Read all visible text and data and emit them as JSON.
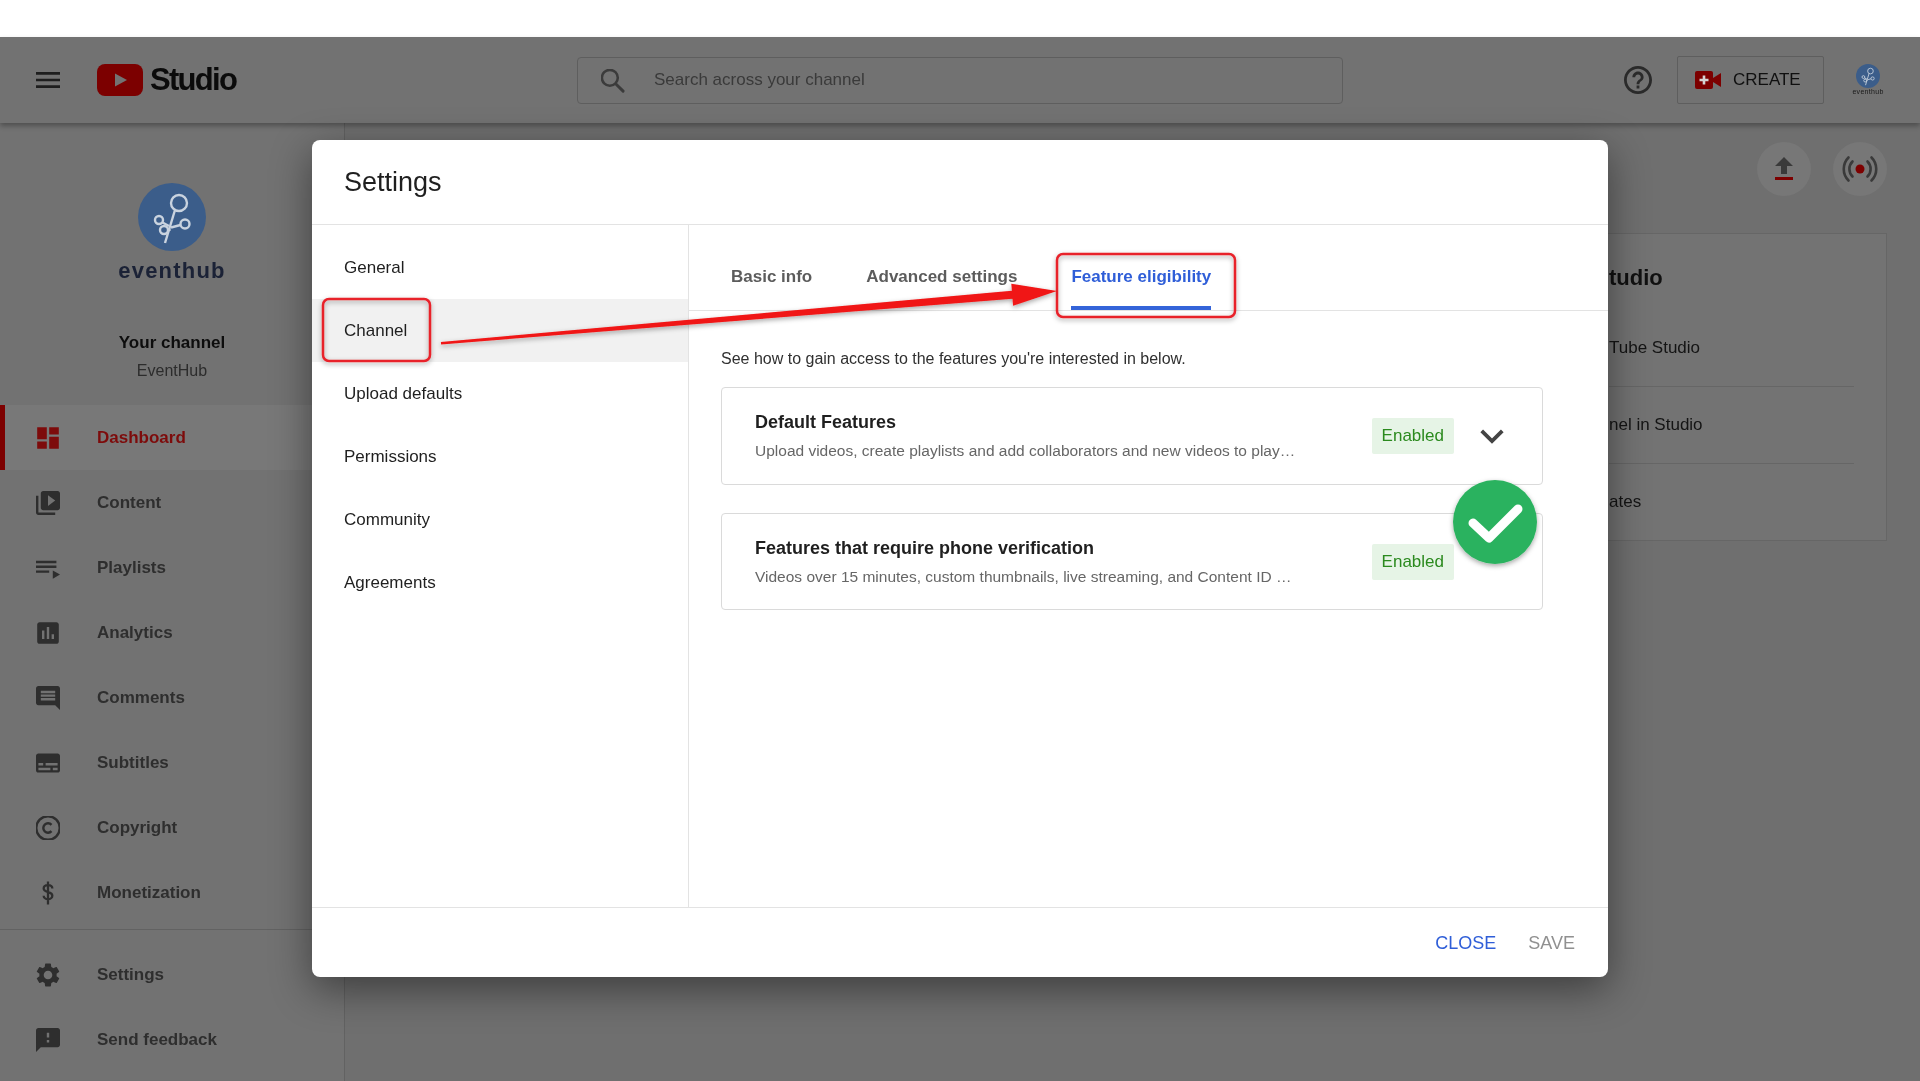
{
  "topbar": {
    "logo_text": "Studio",
    "search": {
      "placeholder": "Search across your channel"
    },
    "create_button": "CREATE",
    "account_label": "eventhub"
  },
  "sidebar": {
    "logo_text": "eventhub",
    "channel_title": "Your channel",
    "channel_name": "EventHub",
    "items": [
      {
        "label": "Dashboard",
        "selected": true
      },
      {
        "label": "Content",
        "selected": false
      },
      {
        "label": "Playlists",
        "selected": false
      },
      {
        "label": "Analytics",
        "selected": false
      },
      {
        "label": "Comments",
        "selected": false
      },
      {
        "label": "Subtitles",
        "selected": false
      },
      {
        "label": "Copyright",
        "selected": false
      },
      {
        "label": "Monetization",
        "selected": false
      }
    ],
    "footer_items": [
      {
        "label": "Settings",
        "selected": false
      },
      {
        "label": "Send feedback",
        "selected": false
      }
    ]
  },
  "background_card": {
    "title": "tudio",
    "rows": [
      "Tube Studio",
      "nel in Studio",
      "ates"
    ]
  },
  "dialog": {
    "title": "Settings",
    "nav": [
      {
        "label": "General",
        "selected": false
      },
      {
        "label": "Channel",
        "selected": true
      },
      {
        "label": "Upload defaults",
        "selected": false
      },
      {
        "label": "Permissions",
        "selected": false
      },
      {
        "label": "Community",
        "selected": false
      },
      {
        "label": "Agreements",
        "selected": false
      }
    ],
    "tabs": [
      {
        "label": "Basic info",
        "selected": false
      },
      {
        "label": "Advanced settings",
        "selected": false
      },
      {
        "label": "Feature eligibility",
        "selected": true
      }
    ],
    "description": "See how to gain access to the features you're interested in below.",
    "features": [
      {
        "title": "Default Features",
        "description": "Upload videos, create playlists and add collaborators and new videos to play…",
        "status": "Enabled",
        "expanded": false
      },
      {
        "title": "Features that require phone verification",
        "description": "Videos over 15 minutes, custom thumbnails, live streaming, and Content ID …",
        "status": "Enabled"
      }
    ],
    "buttons": [
      {
        "label": "CLOSE",
        "disabled": false
      },
      {
        "label": "SAVE",
        "disabled": true
      }
    ]
  }
}
